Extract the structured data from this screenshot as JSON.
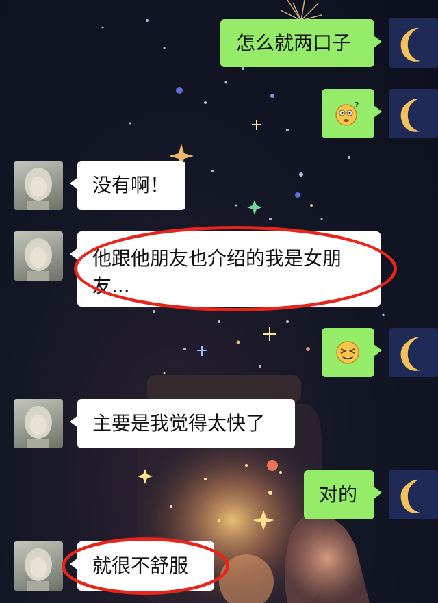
{
  "messages": [
    {
      "side": "right",
      "type": "text",
      "text": "怎么就两口子"
    },
    {
      "side": "right",
      "type": "emoji",
      "emoji": "confused-face-emoji"
    },
    {
      "side": "left",
      "type": "text",
      "text": "没有啊！"
    },
    {
      "side": "left",
      "type": "text",
      "text_line1": "他跟他朋友也介绍的我是女朋",
      "text_line2": "友...",
      "highlighted": true
    },
    {
      "side": "right",
      "type": "emoji",
      "emoji": "grinning-squint-emoji"
    },
    {
      "side": "left",
      "type": "text",
      "text": "主要是我觉得太快了"
    },
    {
      "side": "right",
      "type": "text",
      "text": "对的"
    },
    {
      "side": "left",
      "type": "text",
      "text": "就很不舒服",
      "highlighted": true
    }
  ],
  "avatars": {
    "self": "crescent-moon-avatar",
    "other": "girl-photo-avatar"
  },
  "colors": {
    "sent_bubble": "#95ec69",
    "received_bubble": "#ffffff",
    "highlight_ellipse": "#e8251a",
    "background": "#141726"
  }
}
